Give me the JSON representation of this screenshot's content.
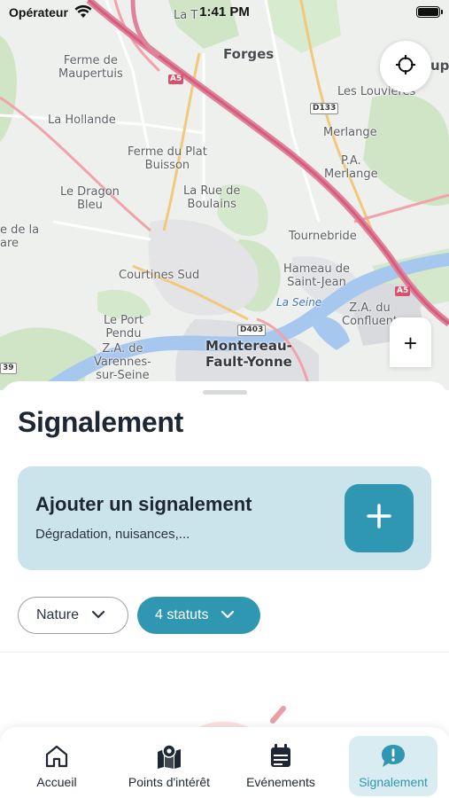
{
  "status_bar": {
    "carrier": "Opérateur",
    "time": "1:41 PM"
  },
  "map": {
    "labels": {
      "la_tuilerie": "La T",
      "forges": "Forges",
      "ferme_maupertuis": "Ferme de\nMaupertuis",
      "la_hollande": "La Hollande",
      "ferme_plat_buisson": "Ferme du Plat\nBuisson",
      "le_dragon_bleu": "Le Dragon\nBleu",
      "la_rue_boulains": "La Rue de\nBoulains",
      "ile_de_la_mare": "e de la\nare",
      "les_louvieres": "Les Louvières",
      "merlange": "Merlange",
      "pa_merlange": "P.A.\nMerlange",
      "tournebride": "Tournebride",
      "hameau_saint_jean": "Hameau de\nSaint-Jean",
      "courtines_sud": "Courtines Sud",
      "la_seine": "La Seine",
      "le_port_pendu": "Le Port\nPendu",
      "za_confluent": "Z.A. du\nConfluent",
      "montereau": "Montereau-\nFault-Yonne",
      "za_varennes": "Z.A. de\nVarennes-\nsur-Seine",
      "top_right_clip": "up"
    },
    "road_badges": {
      "a5_top": "A5",
      "a5_right": "A5",
      "d133": "D133",
      "d403": "D403",
      "r39": "39"
    },
    "locate_icon": "crosshair-icon",
    "zoom_in_label": "+"
  },
  "sheet": {
    "title": "Signalement",
    "add_card": {
      "title": "Ajouter un signalement",
      "subtitle": "Dégradation, nuisances,...",
      "button_icon": "plus-icon"
    },
    "filters": [
      {
        "label": "Nature",
        "icon": "chevron-down-icon"
      },
      {
        "label": "4 statuts",
        "icon": "chevron-down-icon"
      }
    ]
  },
  "tabbar": {
    "tabs": [
      {
        "label": "Accueil",
        "icon": "home-icon",
        "active": false
      },
      {
        "label": "Points d'intérêt",
        "icon": "map-pin-icon",
        "active": false
      },
      {
        "label": "Evénements",
        "icon": "calendar-icon",
        "active": false
      },
      {
        "label": "Signalement",
        "icon": "alert-bubble-icon",
        "active": true
      }
    ]
  },
  "colors": {
    "accent": "#2f97b1",
    "card_bg": "#cbe3ea",
    "active_tab_bg": "#d8ecf1",
    "text_dark": "#1d2733"
  }
}
